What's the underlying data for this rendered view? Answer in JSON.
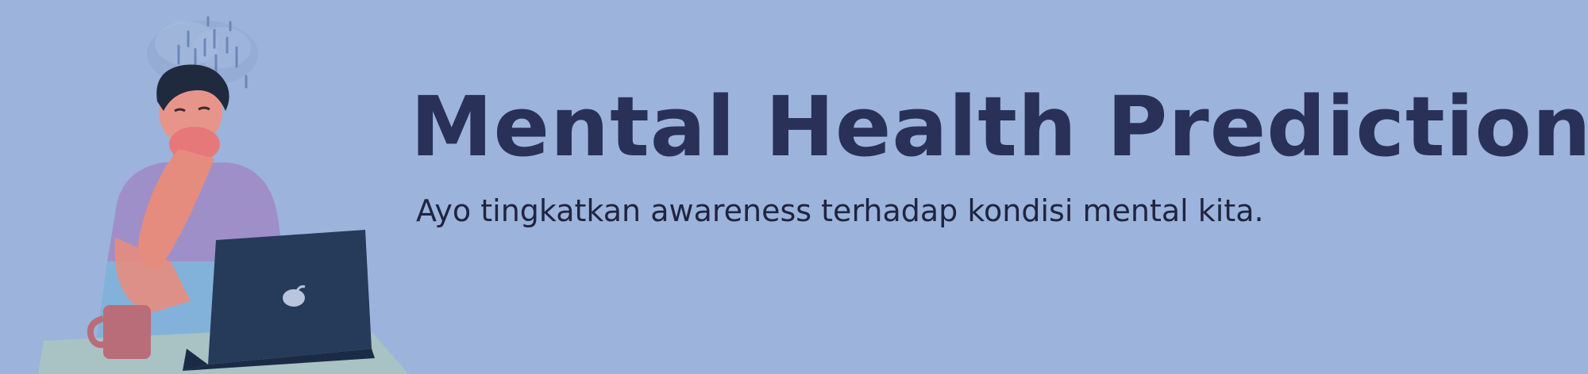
{
  "banner": {
    "title": "Mental Health Prediction",
    "subtitle": "Ayo tingkatkan awareness terhadap kondisi mental kita."
  },
  "illustration": {
    "subject": "stressed-person-at-laptop",
    "colors": {
      "background": "#9cb3dc",
      "title_text": "#293159",
      "laptop": "#263a59",
      "shirt": "#9f8fc8",
      "skin": "#e58c7e",
      "hair": "#1f2a3e",
      "mug": "#b86d78",
      "desk": "#a9c2c4",
      "rain_cloud": "#8aa3c8"
    }
  }
}
